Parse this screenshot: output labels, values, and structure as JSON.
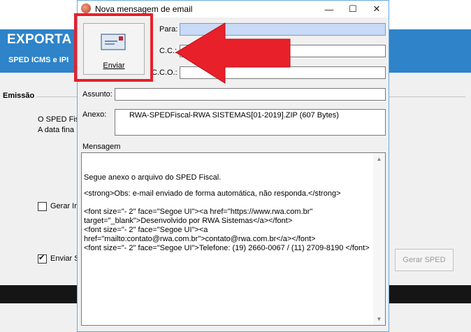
{
  "background_app": {
    "title": "EXPORTA",
    "subtitle": "SPED ICMS e IPI",
    "section_label": "Emissão",
    "text_line1": "O SPED Fisc",
    "text_line2": "A data fina",
    "checkbox1_label": "Gerar In",
    "checkbox1_checked": false,
    "checkbox2_label": "Enviar S",
    "checkbox2_checked": true,
    "gerar_button_label": "Gerar SPED"
  },
  "dialog": {
    "title": "Nova mensagem de email",
    "window_buttons": {
      "minimize": "—",
      "maximize": "☐",
      "close": "✕"
    },
    "send_button_label": "Enviar",
    "fields": {
      "para_label": "Para:",
      "para_value": "",
      "cc_label": "C.C.:",
      "cc_value": "",
      "cco_label": "C.C.O.:",
      "cco_value": "",
      "assunto_label": "Assunto:",
      "assunto_value": ""
    },
    "anexo_label": "Anexo:",
    "anexo_value": "RWA-SPEDFiscal-RWA SISTEMAS[01-2019].ZIP (607 Bytes)",
    "mensagem_label": "Mensagem",
    "message_lines": [
      "Segue anexo o arquivo do SPED Fiscal.",
      "<strong>Obs: e-mail enviado de forma automática, não responda.</strong>",
      "<font size=\"- 2\" face=\"Segoe UI\"><a href=\"https://www.rwa.com.br\"",
      "target=\"_blank\">Desenvolvido por RWA Sistemas</a></font>",
      "<font size=\"- 2\" face=\"Segoe UI\"><a",
      "href=\"mailto:contato@rwa.com.br\">contato@rwa.com.br</a></font>",
      "<font size=\"- 2\" face=\"Segoe UI\">Telefone: (19) 2660-0067 / (11) 2709-8190 </font>"
    ]
  },
  "colors": {
    "header_blue": "#2e83c9",
    "highlight_red": "#e8202a",
    "focus_field": "#c8daf5"
  }
}
